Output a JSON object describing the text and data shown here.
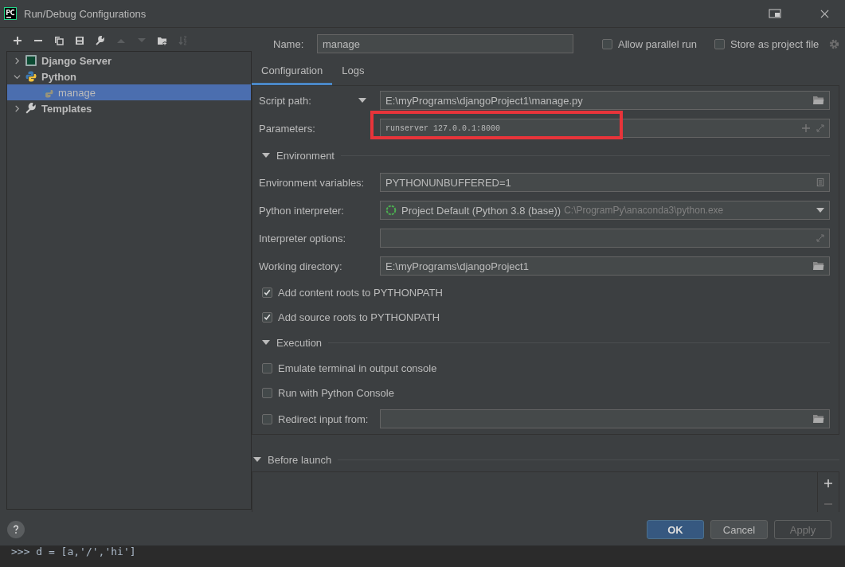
{
  "window": {
    "title": "Run/Debug Configurations"
  },
  "tree": [
    {
      "label": "Django Server",
      "kind": "server",
      "expanded": false,
      "selected": false
    },
    {
      "label": "Python",
      "kind": "python",
      "expanded": true,
      "selected": false,
      "children": [
        {
          "label": "manage",
          "selected": true
        }
      ]
    },
    {
      "label": "Templates",
      "kind": "templates",
      "expanded": false,
      "selected": false
    }
  ],
  "name_field": {
    "label": "Name:",
    "value": "manage"
  },
  "header_options": [
    {
      "label": "Allow parallel run",
      "checked": false
    },
    {
      "label": "Store as project file",
      "checked": false
    }
  ],
  "tabs": [
    {
      "label": "Configuration",
      "selected": true
    },
    {
      "label": "Logs",
      "selected": false
    }
  ],
  "form": [
    {
      "kind": "path",
      "label": "Script path:",
      "value": "E:\\myPrograms\\djangoProject1\\manage.py",
      "label_dropdown": true
    },
    {
      "kind": "params",
      "label": "Parameters:",
      "value": "runserver 127.0.0.1:8000",
      "highlighted": true
    },
    {
      "kind": "section",
      "label": "Environment"
    },
    {
      "kind": "env",
      "label": "Environment variables:",
      "value": "PYTHONUNBUFFERED=1"
    },
    {
      "kind": "interpreter",
      "label": "Python interpreter:",
      "value": "Project Default (Python 3.8 (base))",
      "path": "C:\\ProgramPy\\anaconda3\\python.exe"
    },
    {
      "kind": "options",
      "label": "Interpreter options:"
    },
    {
      "kind": "path",
      "label": "Working directory:",
      "value": "E:\\myPrograms\\djangoProject1"
    },
    {
      "kind": "checkbox",
      "label": "Add content roots to PYTHONPATH",
      "checked": true
    },
    {
      "kind": "checkbox",
      "label": "Add source roots to PYTHONPATH",
      "checked": true
    },
    {
      "kind": "section",
      "label": "Execution"
    },
    {
      "kind": "checkbox",
      "label": "Emulate terminal in output console",
      "checked": false
    },
    {
      "kind": "checkbox",
      "label": "Run with Python Console",
      "checked": false
    },
    {
      "kind": "checkbox-field",
      "label": "Redirect input from:",
      "checked": false
    }
  ],
  "before_launch": {
    "label": "Before launch"
  },
  "buttons": [
    {
      "label": "OK",
      "kind": "primary",
      "disabled": false
    },
    {
      "label": "Cancel",
      "kind": "normal",
      "disabled": false
    },
    {
      "label": "Apply",
      "kind": "normal",
      "disabled": true
    }
  ],
  "console": {
    "line": ">>> d = [a,'/','hi']"
  }
}
